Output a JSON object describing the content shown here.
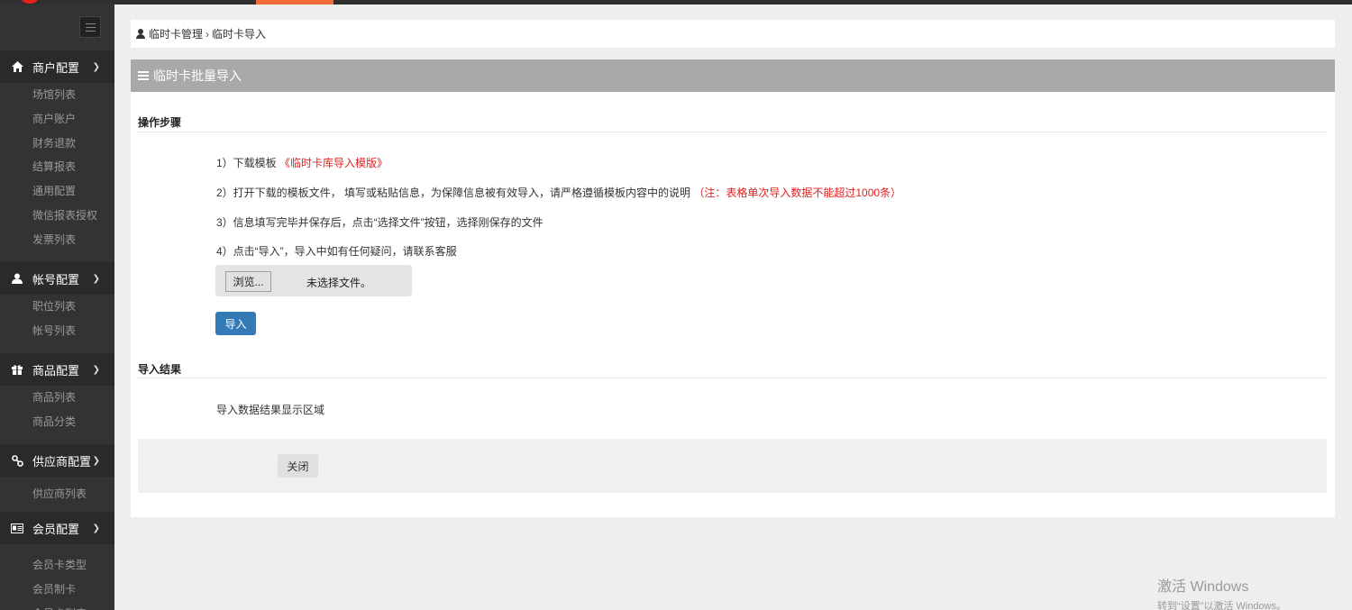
{
  "sidebar": {
    "groups": [
      {
        "label": "商户配置",
        "icon": "home-icon",
        "items": [
          "场馆列表",
          "商户账户",
          "财务退款",
          "结算报表",
          "通用配置",
          "微信报表授权",
          "发票列表"
        ]
      },
      {
        "label": "帐号配置",
        "icon": "user-icon",
        "items": [
          "职位列表",
          "帐号列表"
        ]
      },
      {
        "label": "商品配置",
        "icon": "gift-icon",
        "items": [
          "商品列表",
          "商品分类"
        ]
      },
      {
        "label": "供应商配置",
        "icon": "link-icon",
        "items": [
          "供应商列表"
        ]
      },
      {
        "label": "会员配置",
        "icon": "id-card-icon",
        "items": [
          "会员卡类型",
          "会员制卡",
          "会员卡列表"
        ]
      }
    ]
  },
  "breadcrumb": {
    "parent": "临时卡管理",
    "separator": "›",
    "current": "临时卡导入"
  },
  "panel": {
    "title": "临时卡批量导入",
    "steps_title": "操作步骤",
    "steps": {
      "s1_text": "1）下载模板 ",
      "s1_link": "《临时卡库导入模版》",
      "s2_text": "2）打开下载的模板文件， 填写或粘贴信息，为保障信息被有效导入，请严格遵循模板内容中的说明 ",
      "s2_note": "（注：表格单次导入数据不能超过1000条）",
      "s3_text": "3）信息填写完毕并保存后，点击“选择文件”按钮，选择刚保存的文件",
      "s4_text": "4）点击“导入”，导入中如有任何疑问，请联系客服"
    },
    "file_input": {
      "browse_label": "浏览...",
      "status": "未选择文件。"
    },
    "import_label": "导入",
    "result_title": "导入结果",
    "result_text": "导入数据结果显示区域",
    "close_label": "关闭"
  },
  "watermark": {
    "line1": "激活 Windows",
    "line2": "转到“设置”以激活 Windows。"
  },
  "colors": {
    "sidebar_bg": "#333333",
    "panel_header": "#a9a9a9",
    "primary": "#337ab7",
    "warning_red": "#e02020",
    "top_accent": "#f26a35"
  }
}
